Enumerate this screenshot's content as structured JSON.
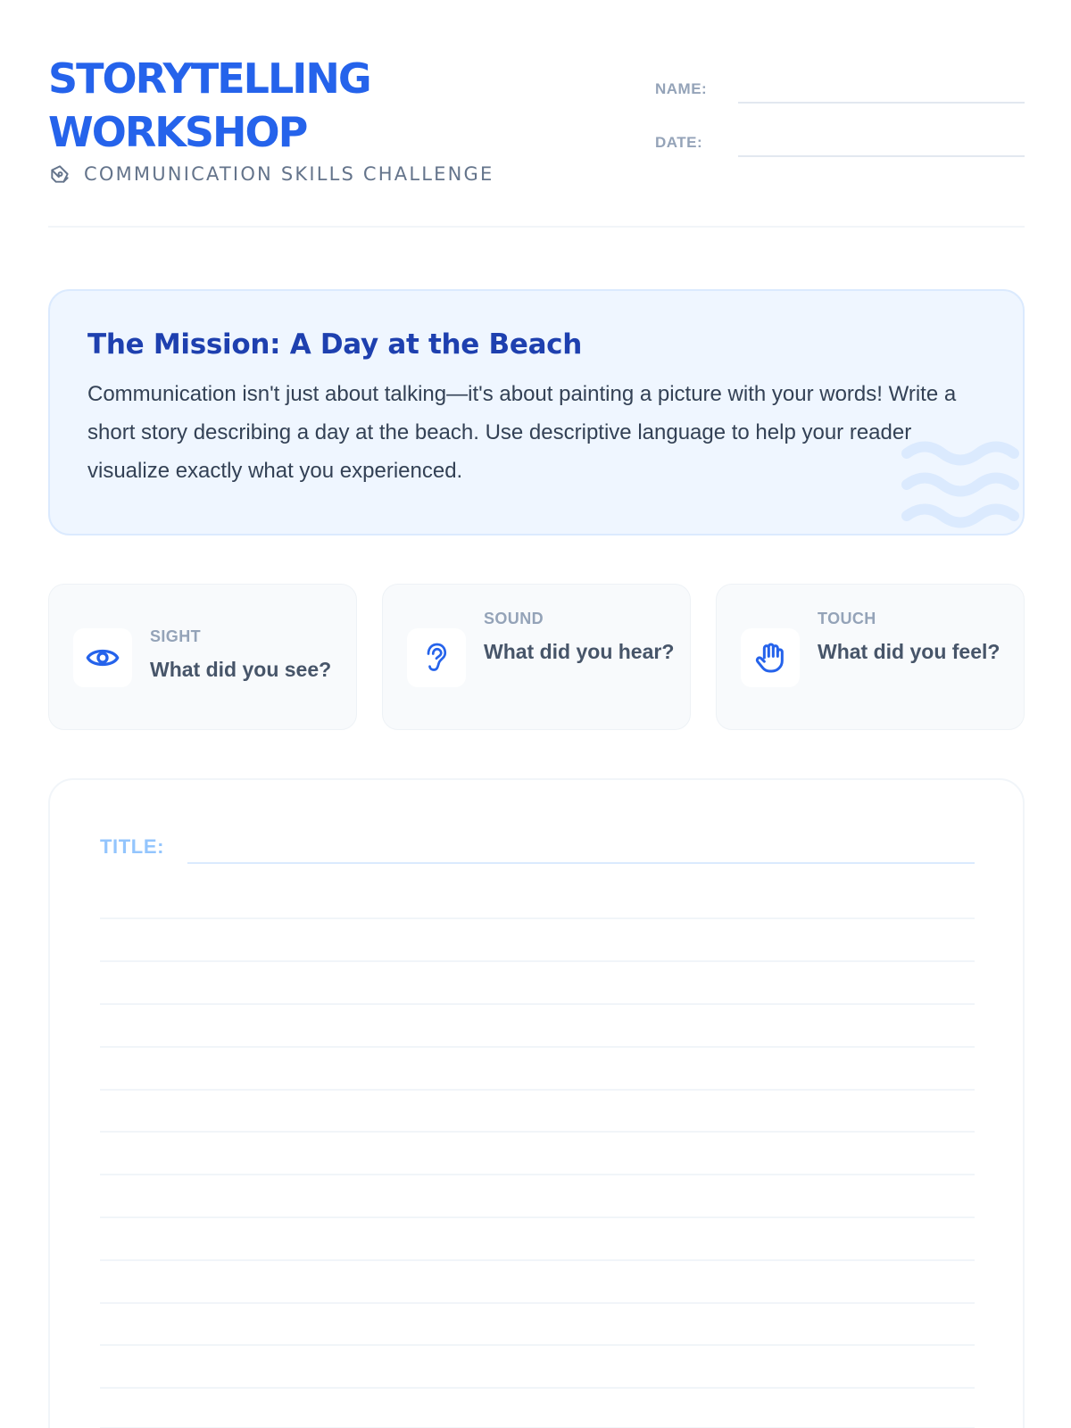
{
  "header": {
    "title_line1": "STORYTELLING",
    "title_line2": "WORKSHOP",
    "subtitle_icon": "pen-nib-icon",
    "subtitle": "COMMUNICATION SKILLS CHALLENGE",
    "fields": [
      {
        "label": "NAME:",
        "value": ""
      },
      {
        "label": "DATE:",
        "value": ""
      }
    ]
  },
  "mission": {
    "title": "The Mission: A Day at the Beach",
    "text": "Communication isn't just about talking—it's about painting a picture with your words! Write a short story describing a day at the beach. Use descriptive language to help your reader visualize exactly what you experienced.",
    "decoration_icon": "waves-icon"
  },
  "senses": [
    {
      "icon": "eye-icon",
      "label": "SIGHT",
      "question": "What did you see?"
    },
    {
      "icon": "ear-icon",
      "label": "SOUND",
      "question": "What did you hear?"
    },
    {
      "icon": "hand-icon",
      "label": "TOUCH",
      "question": "What did you feel?"
    }
  ],
  "writing": {
    "title_label": "TITLE:",
    "title_value": ""
  },
  "colors": {
    "brand_blue": "#2563eb",
    "mission_title": "#1e40af",
    "mission_bg": "#eff6ff",
    "label_gray": "#94a3b8",
    "title_label": "#93c5fd"
  }
}
